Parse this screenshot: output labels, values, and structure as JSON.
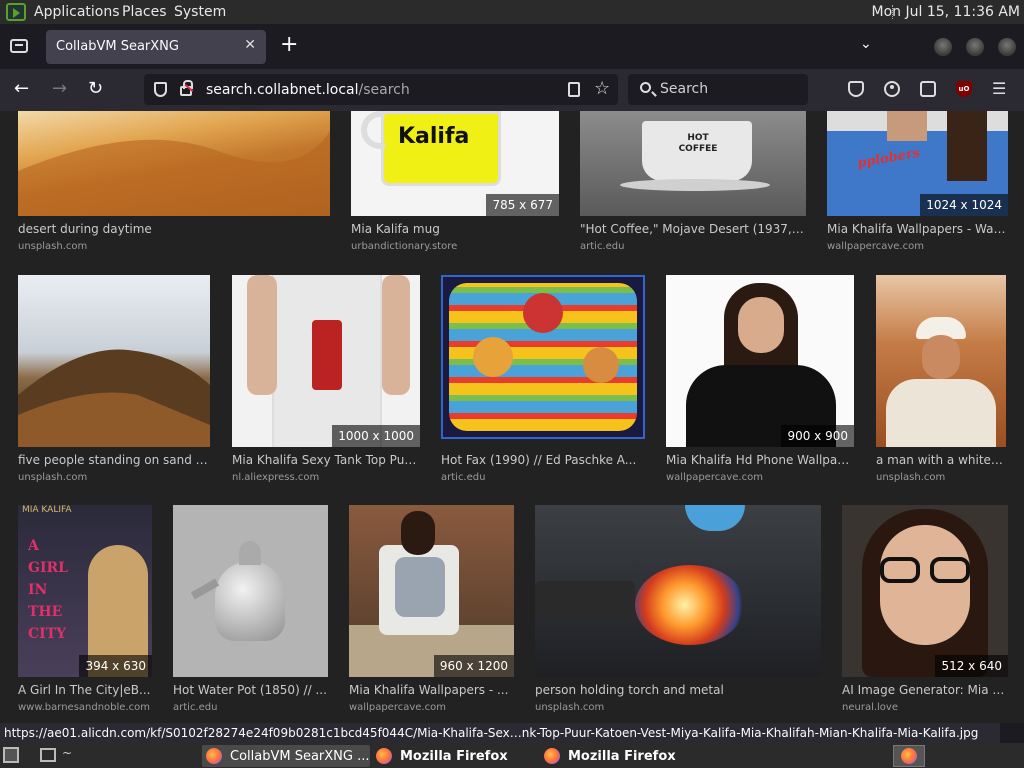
{
  "top_panel": {
    "menus": [
      "Applications",
      "Places",
      "System"
    ],
    "clock": "Mon Jul 15, 11:36 AM"
  },
  "browser": {
    "tab_title": "CollabVM SearXNG",
    "tab_close": "✕",
    "new_tab": "+",
    "url_host": "search.collabnet.local",
    "url_path": "/search",
    "search_placeholder": "Search"
  },
  "results": [
    {
      "title": "desert during daytime",
      "source": "unsplash.com",
      "dims": ""
    },
    {
      "title": "Mia Kalifa mug",
      "source": "urbandictionary.store",
      "dims": "785 x 677"
    },
    {
      "title": "\"Hot Coffee,\" Mojave Desert (1937, p...",
      "source": "artic.edu",
      "dims": ""
    },
    {
      "title": "Mia Khalifa Wallpapers - Wall...",
      "source": "wallpapercave.com",
      "dims": "1024 x 1024"
    },
    {
      "title": "five people standing on sand d...",
      "source": "unsplash.com",
      "dims": ""
    },
    {
      "title": "Mia Khalifa Sexy Tank Top Puu...",
      "source": "nl.aliexpress.com",
      "dims": "1000 x 1000"
    },
    {
      "title": "Hot Fax (1990) // Ed Paschke A...",
      "source": "artic.edu",
      "dims": ""
    },
    {
      "title": "Mia Khalifa Hd Phone Wallpap...",
      "source": "wallpapercave.com",
      "dims": "900 x 900"
    },
    {
      "title": "a man with a white t...",
      "source": "unsplash.com",
      "dims": ""
    },
    {
      "title": "A Girl In The City|eB...",
      "source": "www.barnesandnoble.com",
      "dims": "394 x 630"
    },
    {
      "title": "Hot Water Pot (1850) // ...",
      "source": "artic.edu",
      "dims": ""
    },
    {
      "title": "Mia Khalifa Wallpapers - ...",
      "source": "wallpapercave.com",
      "dims": "960 x 1200"
    },
    {
      "title": "person holding torch and metal",
      "source": "unsplash.com",
      "dims": ""
    },
    {
      "title": "AI Image Generator: Mia K...",
      "source": "neural.love",
      "dims": "512 x 640"
    }
  ],
  "image_text": {
    "mug": "Kalifa",
    "coffee_cup": "HOT COFFEE",
    "book_cover_author": "MIA KALIFA",
    "book_cover_title": "A GIRL IN THE CITY",
    "shirt": "pplobers"
  },
  "status_url": "https://ae01.alicdn.com/kf/S0102f28274e24f09b0281c1bcd45f044C/Mia-Khalifa-Sex…nk-Top-Puur-Katoen-Vest-Miya-Kalifa-Mia-Khalifah-Mian-Khalifa-Mia-Kalifa.jpg",
  "taskbar": {
    "windows": [
      "CollabVM SearXNG ...",
      "Mozilla Firefox",
      "Mozilla Firefox"
    ],
    "terminal_arrow": "~"
  },
  "colors": {
    "page_bg": "#222222",
    "chrome_bg": "#2b2a33",
    "tab_bg": "#42414d",
    "caption": "#c9c9c9"
  }
}
